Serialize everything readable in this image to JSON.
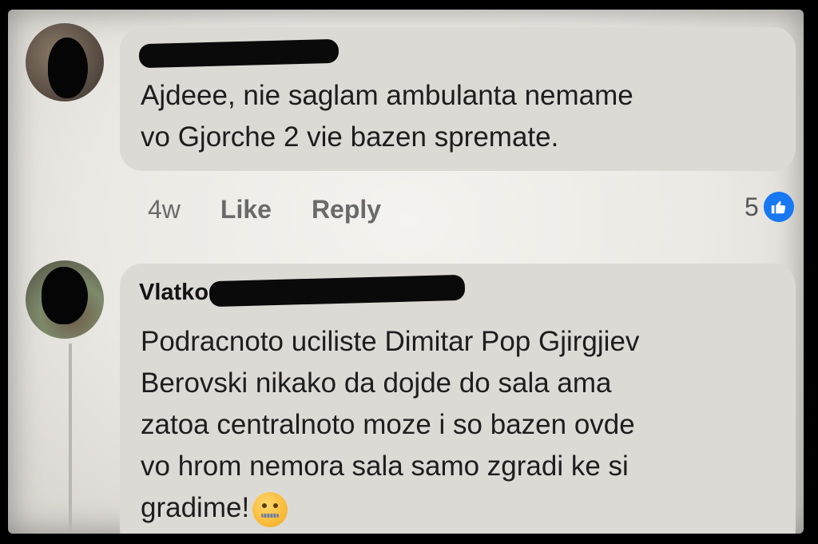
{
  "comments": [
    {
      "author_visible": "",
      "text": "Ajdeee, nie saglam ambulanta nemame\nvo Gjorche 2 vie bazen spremate.",
      "time": "4w",
      "like_label": "Like",
      "reply_label": "Reply",
      "reaction_count": "5"
    },
    {
      "author_visible": "Vlatko",
      "text": "Podracnoto uciliste Dimitar Pop Gjirgjiev\nBerovski nikako da dojde do sala ama\nzatoa centralnoto moze i so bazen ovde\nvo hrom nemora sala samo zgradi ke si\ngradime!",
      "emoji": "zipper-mouth-face-icon"
    }
  ],
  "colors": {
    "like_blue": "#1877f2",
    "bubble": "#dcdad5",
    "meta_text": "#6a6a6a"
  }
}
